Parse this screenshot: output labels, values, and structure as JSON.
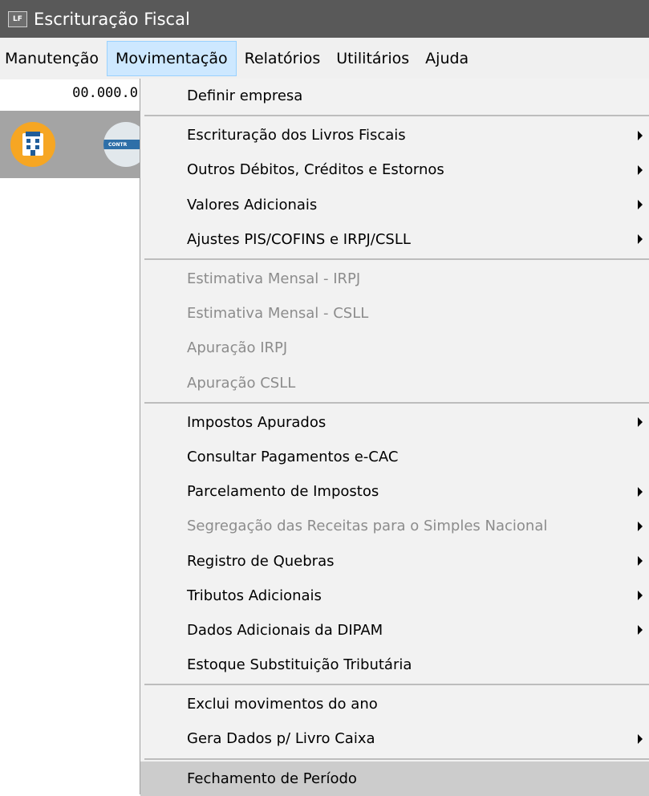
{
  "window": {
    "app_icon": "LF",
    "title": "Escrituração Fiscal"
  },
  "menubar": {
    "items": [
      "Manutenção",
      "Movimentação",
      "Relatórios",
      "Utilitários",
      "Ajuda"
    ],
    "active": "Movimentação"
  },
  "company_code": "00.000.0",
  "toolbar": {
    "button1_icon": "building-icon",
    "button2_label": "CONTR"
  },
  "menu": {
    "groups": [
      [
        {
          "label": "Definir empresa",
          "submenu": false,
          "enabled": true
        }
      ],
      [
        {
          "label": "Escrituração dos Livros Fiscais",
          "submenu": true,
          "enabled": true
        },
        {
          "label": "Outros Débitos, Créditos e Estornos",
          "submenu": true,
          "enabled": true
        },
        {
          "label": "Valores Adicionais",
          "submenu": true,
          "enabled": true
        },
        {
          "label": "Ajustes PIS/COFINS e IRPJ/CSLL",
          "submenu": true,
          "enabled": true
        }
      ],
      [
        {
          "label": "Estimativa Mensal - IRPJ",
          "submenu": false,
          "enabled": false
        },
        {
          "label": "Estimativa Mensal - CSLL",
          "submenu": false,
          "enabled": false
        },
        {
          "label": "Apuração IRPJ",
          "submenu": false,
          "enabled": false
        },
        {
          "label": "Apuração CSLL",
          "submenu": false,
          "enabled": false
        }
      ],
      [
        {
          "label": "Impostos Apurados",
          "submenu": true,
          "enabled": true
        },
        {
          "label": "Consultar Pagamentos e-CAC",
          "submenu": false,
          "enabled": true
        },
        {
          "label": "Parcelamento de Impostos",
          "submenu": true,
          "enabled": true
        },
        {
          "label": "Segregação das Receitas para o Simples Nacional",
          "submenu": true,
          "enabled": false
        },
        {
          "label": "Registro de Quebras",
          "submenu": true,
          "enabled": true
        },
        {
          "label": "Tributos Adicionais",
          "submenu": true,
          "enabled": true
        },
        {
          "label": "Dados Adicionais da DIPAM",
          "submenu": true,
          "enabled": true
        },
        {
          "label": "Estoque Substituição Tributária",
          "submenu": false,
          "enabled": true
        }
      ],
      [
        {
          "label": "Exclui movimentos do ano",
          "submenu": false,
          "enabled": true
        },
        {
          "label": "Gera Dados p/ Livro Caixa",
          "submenu": true,
          "enabled": true
        }
      ],
      [
        {
          "label": "Fechamento de Período",
          "submenu": false,
          "enabled": true,
          "highlighted": true
        }
      ]
    ]
  }
}
